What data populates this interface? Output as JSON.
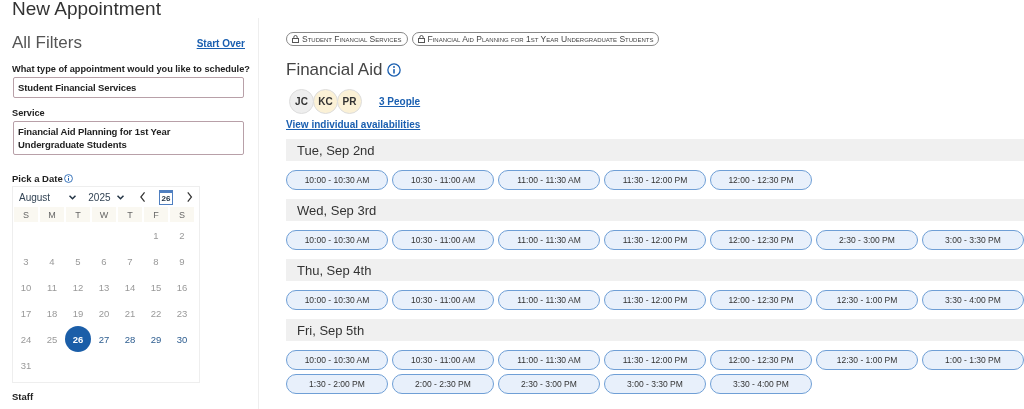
{
  "page_title": "New Appointment",
  "filters": {
    "title": "All Filters",
    "start_over": "Start Over",
    "fields": [
      {
        "label": "What type of appointment would you like to schedule?",
        "value": "Student Financial Services"
      },
      {
        "label": "Service",
        "value": "Financial Aid Planning for 1st Year Undergraduate Students"
      }
    ],
    "date_label": "Pick a Date",
    "calendar": {
      "month": "August",
      "year": "2025",
      "today": "26",
      "weekdays": [
        "S",
        "M",
        "T",
        "W",
        "T",
        "F",
        "S"
      ],
      "weeks": [
        [
          {
            "day": "1",
            "disabled": true,
            "selected": false
          },
          {
            "day": "2",
            "disabled": true,
            "selected": false
          }
        ],
        [
          {
            "day": "3",
            "disabled": true,
            "selected": false
          },
          {
            "day": "4",
            "disabled": true,
            "selected": false
          },
          {
            "day": "5",
            "disabled": true,
            "selected": false
          },
          {
            "day": "6",
            "disabled": true,
            "selected": false
          },
          {
            "day": "7",
            "disabled": true,
            "selected": false
          },
          {
            "day": "8",
            "disabled": true,
            "selected": false
          },
          {
            "day": "9",
            "disabled": true,
            "selected": false
          }
        ],
        [
          {
            "day": "10",
            "disabled": true,
            "selected": false
          },
          {
            "day": "11",
            "disabled": true,
            "selected": false
          },
          {
            "day": "12",
            "disabled": true,
            "selected": false
          },
          {
            "day": "13",
            "disabled": true,
            "selected": false
          },
          {
            "day": "14",
            "disabled": true,
            "selected": false
          },
          {
            "day": "15",
            "disabled": true,
            "selected": false
          },
          {
            "day": "16",
            "disabled": true,
            "selected": false
          }
        ],
        [
          {
            "day": "17",
            "disabled": true,
            "selected": false
          },
          {
            "day": "18",
            "disabled": true,
            "selected": false
          },
          {
            "day": "19",
            "disabled": true,
            "selected": false
          },
          {
            "day": "20",
            "disabled": true,
            "selected": false
          },
          {
            "day": "21",
            "disabled": true,
            "selected": false
          },
          {
            "day": "22",
            "disabled": true,
            "selected": false
          },
          {
            "day": "23",
            "disabled": true,
            "selected": false
          }
        ],
        [
          {
            "day": "24",
            "disabled": true,
            "selected": false
          },
          {
            "day": "25",
            "disabled": true,
            "selected": false
          },
          {
            "day": "26",
            "disabled": false,
            "selected": true
          },
          {
            "day": "27",
            "disabled": false,
            "selected": false
          },
          {
            "day": "28",
            "disabled": false,
            "selected": false
          },
          {
            "day": "29",
            "disabled": false,
            "selected": false
          },
          {
            "day": "30",
            "disabled": false,
            "selected": false
          }
        ],
        [
          {
            "day": "31",
            "disabled": true,
            "selected": false
          }
        ]
      ]
    },
    "staff_label": "Staff"
  },
  "chips": [
    "Student Financial Services",
    "Financial Aid Planning for 1st Year Undergraduate Students"
  ],
  "heading": "Financial Aid",
  "people": {
    "avatars": [
      {
        "initials": "JC",
        "color": "#eeeeee"
      },
      {
        "initials": "KC",
        "color": "#fbf1d6"
      },
      {
        "initials": "PR",
        "color": "#fbf1d6"
      }
    ],
    "count_link": "3 People",
    "availability_link": "View individual availabilities"
  },
  "days": [
    {
      "date": "Tue, Sep 2nd",
      "slots": [
        "10:00 - 10:30 AM",
        "10:30 - 11:00 AM",
        "11:00 - 11:30 AM",
        "11:30 - 12:00 PM",
        "12:00 - 12:30 PM"
      ]
    },
    {
      "date": "Wed, Sep 3rd",
      "slots": [
        "10:00 - 10:30 AM",
        "10:30 - 11:00 AM",
        "11:00 - 11:30 AM",
        "11:30 - 12:00 PM",
        "12:00 - 12:30 PM",
        "2:30 - 3:00 PM",
        "3:00 - 3:30 PM"
      ]
    },
    {
      "date": "Thu, Sep 4th",
      "slots": [
        "10:00 - 10:30 AM",
        "10:30 - 11:00 AM",
        "11:00 - 11:30 AM",
        "11:30 - 12:00 PM",
        "12:00 - 12:30 PM",
        "12:30 - 1:00 PM",
        "3:30 - 4:00 PM"
      ]
    },
    {
      "date": "Fri, Sep 5th",
      "slots": [
        "10:00 - 10:30 AM",
        "10:30 - 11:00 AM",
        "11:00 - 11:30 AM",
        "11:30 - 12:00 PM",
        "12:00 - 12:30 PM",
        "12:30 - 1:00 PM",
        "1:00 - 1:30 PM",
        "1:30 - 2:00 PM",
        "2:00 - 2:30 PM",
        "2:30 - 3:00 PM",
        "3:00 - 3:30 PM",
        "3:30 - 4:00 PM"
      ]
    }
  ]
}
